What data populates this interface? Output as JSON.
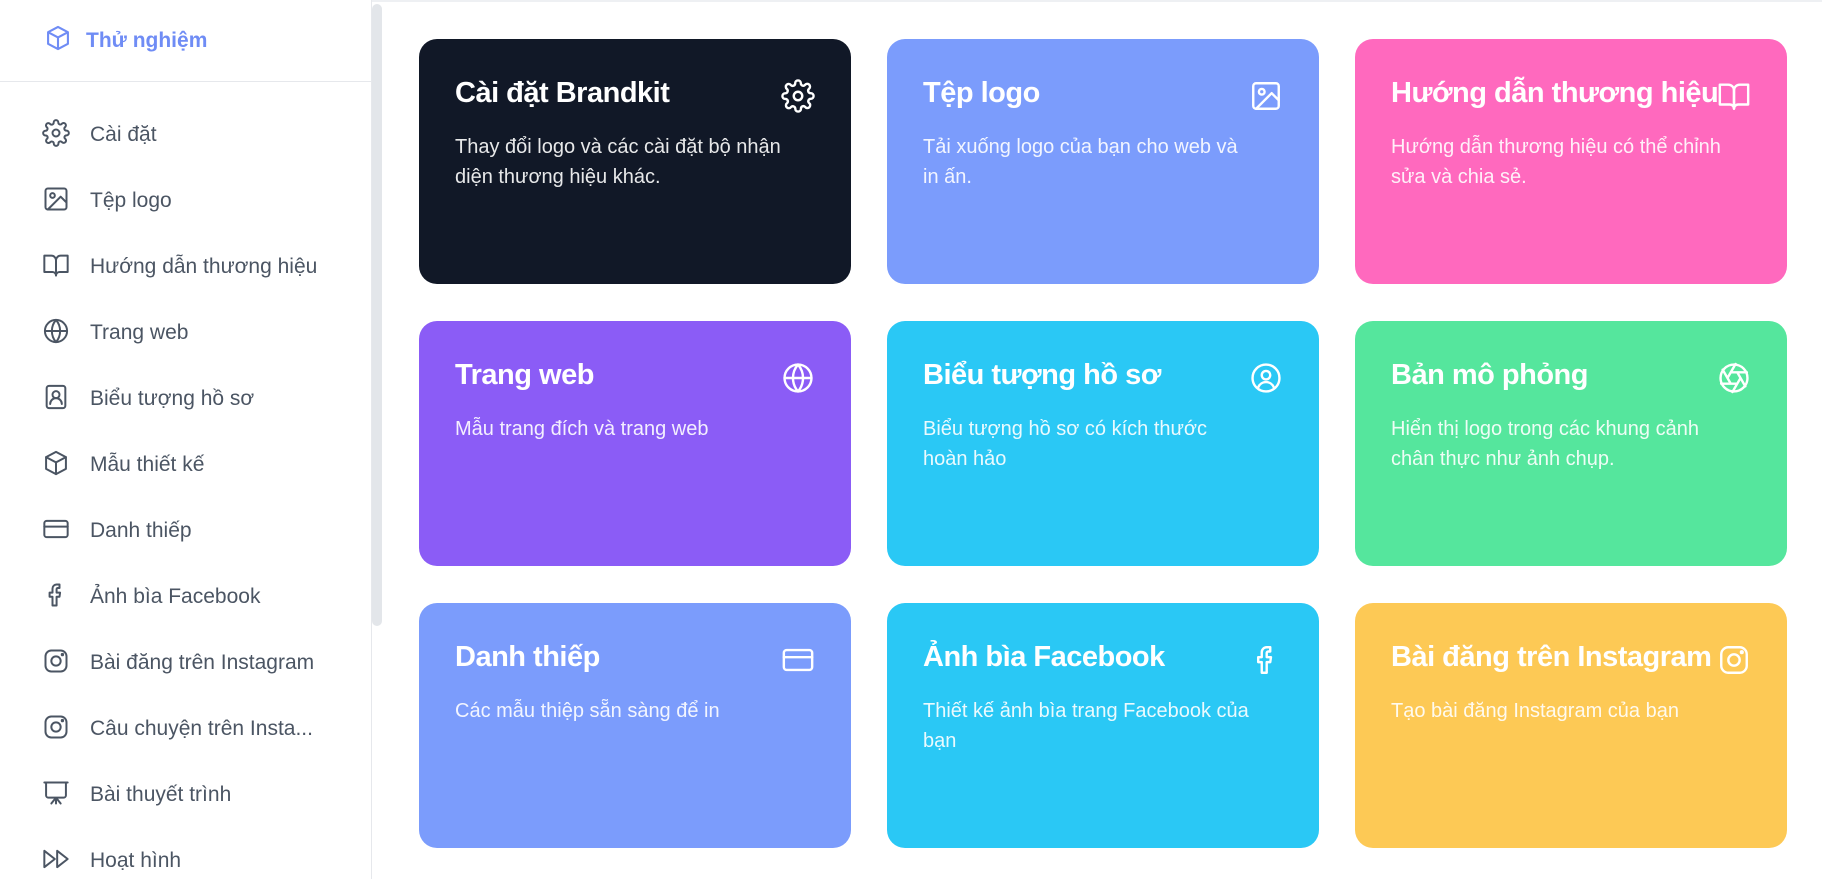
{
  "sidebar": {
    "brand": {
      "label": "Thử nghiệm",
      "icon": "cube-icon",
      "color": "#6f8cf5"
    },
    "items": [
      {
        "label": "Cài đặt",
        "icon": "gear-icon"
      },
      {
        "label": "Tệp logo",
        "icon": "image-icon"
      },
      {
        "label": "Hướng dẫn thương hiệu",
        "icon": "book-icon"
      },
      {
        "label": "Trang web",
        "icon": "globe-icon"
      },
      {
        "label": "Biểu tượng hồ sơ",
        "icon": "profile-icon"
      },
      {
        "label": "Mẫu thiết kế",
        "icon": "cube-icon"
      },
      {
        "label": "Danh thiếp",
        "icon": "card-icon"
      },
      {
        "label": "Ảnh bìa Facebook",
        "icon": "facebook-icon"
      },
      {
        "label": "Bài đăng trên Instagram",
        "icon": "instagram-icon"
      },
      {
        "label": "Câu chuyện trên Insta...",
        "icon": "instagram-icon"
      },
      {
        "label": "Bài thuyết trình",
        "icon": "presentation-icon"
      },
      {
        "label": "Hoạt hình",
        "icon": "fast-forward-icon"
      }
    ]
  },
  "cards": [
    {
      "title": "Cài đặt Brandkit",
      "desc": "Thay đổi logo và các cài đặt bộ nhận diện thương hiệu khác.",
      "icon": "gear-icon",
      "color": "#111827"
    },
    {
      "title": "Tệp logo",
      "desc": "Tải xuống logo của bạn cho web và in ấn.",
      "icon": "image-icon",
      "color": "#7b9cfc"
    },
    {
      "title": "Hướng dẫn thương hiệu",
      "desc": "Hướng dẫn thương hiệu có thể chỉnh sửa và chia sẻ.",
      "icon": "book-icon",
      "color": "#ff69be"
    },
    {
      "title": "Trang web",
      "desc": "Mẫu trang đích và trang web",
      "icon": "globe-icon",
      "color": "#8b5cf6"
    },
    {
      "title": "Biểu tượng hồ sơ",
      "desc": "Biểu tượng hồ sơ có kích thước hoàn hảo",
      "icon": "profile-icon",
      "color": "#2ac8f5"
    },
    {
      "title": "Bản mô phỏng",
      "desc": "Hiển thị logo trong các khung cảnh chân thực như ảnh chụp.",
      "icon": "aperture-icon",
      "color": "#55e69d"
    },
    {
      "title": "Danh thiếp",
      "desc": "Các mẫu thiệp sẵn sàng để in",
      "icon": "card-icon",
      "color": "#7b9cfc"
    },
    {
      "title": "Ảnh bìa Facebook",
      "desc": "Thiết kế ảnh bìa trang Facebook của bạn",
      "icon": "facebook-icon",
      "color": "#2ac8f5"
    },
    {
      "title": "Bài đăng trên Instagram",
      "desc": "Tạo bài đăng Instagram của bạn",
      "icon": "instagram-icon",
      "color": "#fdc955"
    }
  ]
}
